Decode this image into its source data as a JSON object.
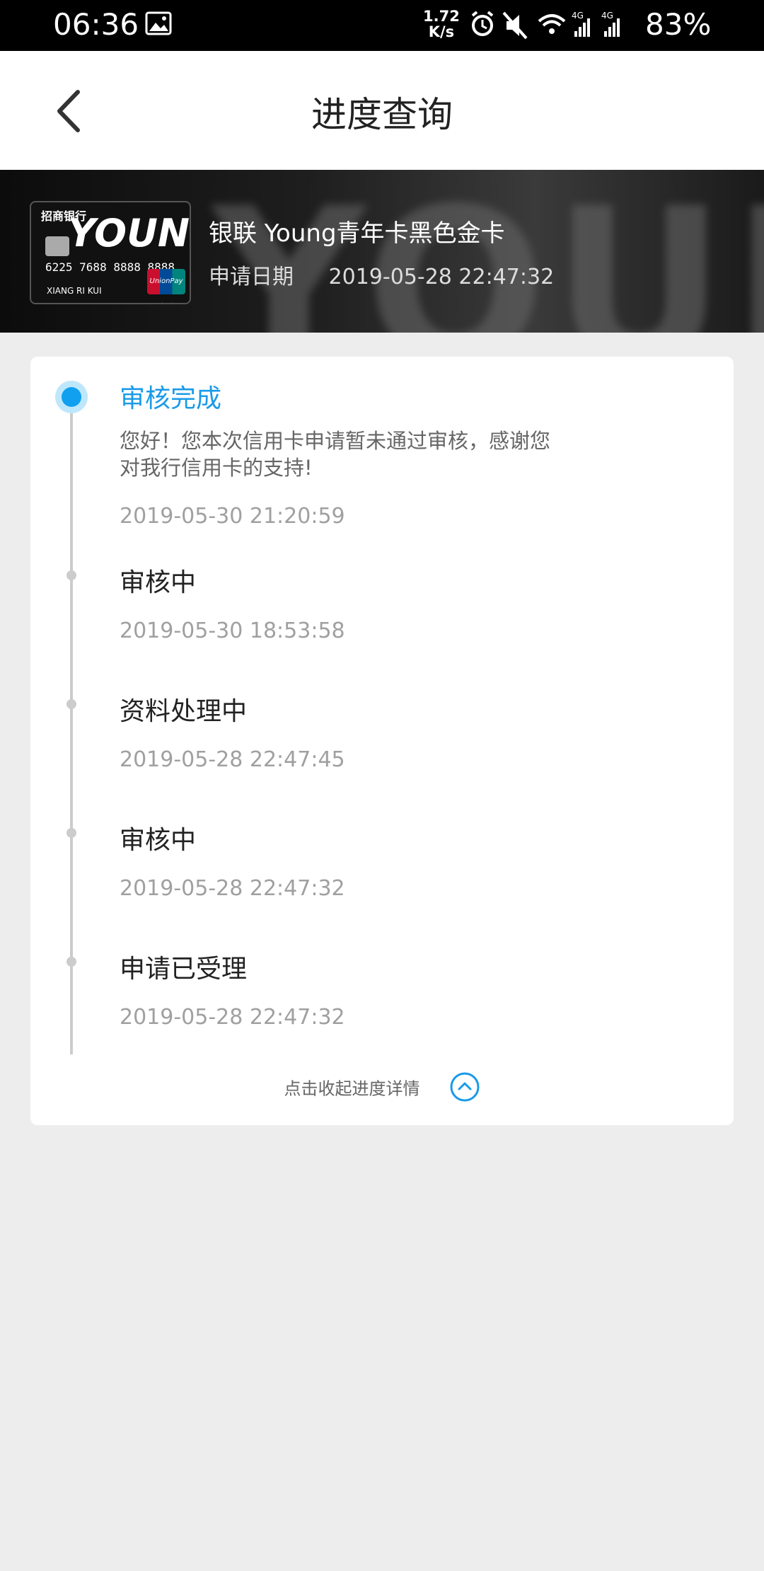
{
  "status_bar": {
    "time": "06:36",
    "net_speed_value": "1.72",
    "net_speed_unit": "K/s",
    "battery": "83%"
  },
  "header": {
    "title": "进度查询"
  },
  "banner": {
    "card_name": "银联 Young青年卡黑色金卡",
    "apply_label": "申请日期",
    "apply_date": "2019-05-28 22:47:32",
    "card_brand": "招商银行",
    "card_young": "YOUNG",
    "card_number": "6225 7688 8888 8888",
    "card_holder": "XIANG RI KUI",
    "card_network": "UnionPay 银联"
  },
  "progress": {
    "steps": [
      {
        "title": "审核完成",
        "message": "您好！您本次信用卡申请暂未通过审核，感谢您对我行信用卡的支持!",
        "time": "2019-05-30 21:20:59"
      },
      {
        "title": "审核中",
        "time": "2019-05-30 18:53:58"
      },
      {
        "title": "资料处理中",
        "time": "2019-05-28 22:47:45"
      },
      {
        "title": "审核中",
        "time": "2019-05-28 22:47:32"
      },
      {
        "title": "申请已受理",
        "time": "2019-05-28 22:47:32"
      }
    ],
    "collapse_label": "点击收起进度详情"
  },
  "colors": {
    "accent": "#1a9ae8",
    "background": "#ededed"
  }
}
